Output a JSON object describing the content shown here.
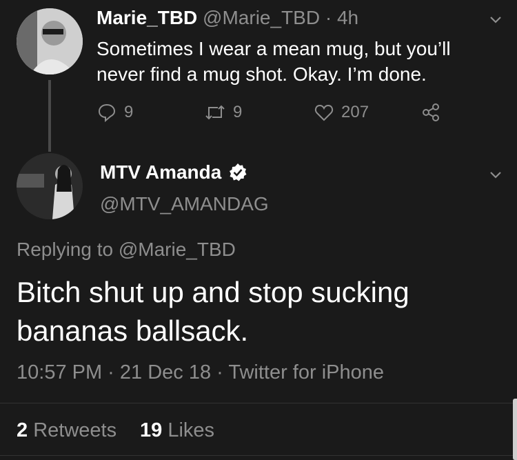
{
  "parent_tweet": {
    "display_name": "Marie_TBD",
    "handle_time": "@Marie_TBD · 4h",
    "text_line1": "Sometimes I wear a mean mug, but you’ll",
    "text_line2": "never find a mug shot. Okay. I’m done.",
    "reply_count": "9",
    "retweet_count": "9",
    "like_count": "207"
  },
  "main_tweet": {
    "display_name": "MTV Amanda",
    "handle": "@MTV_AMANDAG",
    "replying_to": "Replying to @Marie_TBD",
    "text_line1": "Bitch shut up and stop sucking",
    "text_line2": "bananas ballsack.",
    "meta": "10:57 PM · 21 Dec 18 · Twitter for iPhone"
  },
  "stats": {
    "retweets_count": "2",
    "retweets_label": "Retweets",
    "likes_count": "19",
    "likes_label": "Likes"
  },
  "icons": {
    "verified": "verified-badge-icon",
    "reply": "reply-icon",
    "retweet": "retweet-icon",
    "like": "heart-icon",
    "share": "share-icon",
    "chevron": "chevron-down-icon"
  }
}
